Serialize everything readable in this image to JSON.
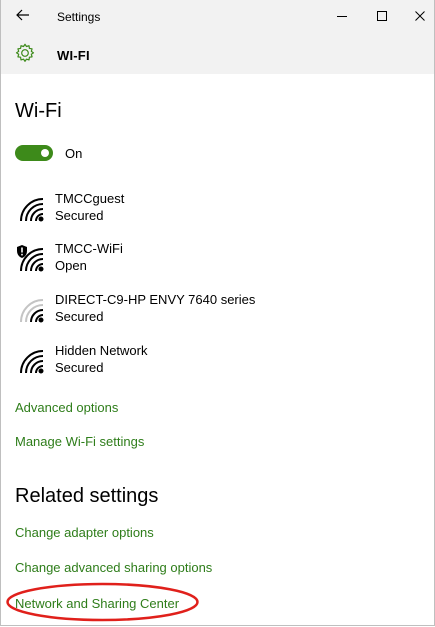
{
  "window": {
    "title": "Settings"
  },
  "header": {
    "title": "WI-FI"
  },
  "wifi": {
    "heading": "Wi-Fi",
    "toggle_state": "On"
  },
  "networks": [
    {
      "name": "TMCCguest",
      "status": "Secured",
      "shield": false,
      "signal": "full"
    },
    {
      "name": "TMCC-WiFi",
      "status": "Open",
      "shield": true,
      "signal": "full"
    },
    {
      "name": "DIRECT-C9-HP ENVY 7640 series",
      "status": "Secured",
      "shield": false,
      "signal": "weak"
    },
    {
      "name": "Hidden Network",
      "status": "Secured",
      "shield": false,
      "signal": "full"
    }
  ],
  "links": {
    "advanced": "Advanced options",
    "manage": "Manage Wi-Fi settings"
  },
  "related": {
    "heading": "Related settings",
    "adapter": "Change adapter options",
    "sharing": "Change advanced sharing options",
    "network_center": "Network and Sharing Center"
  },
  "colors": {
    "accent": "#3d8a1a",
    "link": "#2e7d1a",
    "annotation": "#e0201b"
  }
}
